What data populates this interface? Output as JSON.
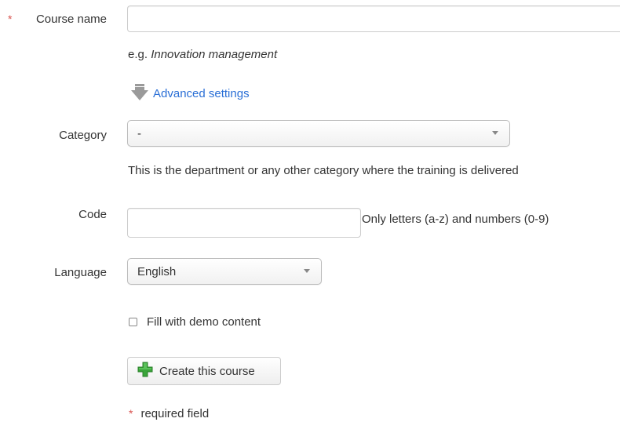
{
  "form": {
    "course_name": {
      "required_mark": "*",
      "label": "Course name",
      "value": "",
      "hint_prefix": "e.g.",
      "hint_example": "Innovation management"
    },
    "advanced_settings": {
      "label": "Advanced settings",
      "icon": "download-arrow-icon"
    },
    "category": {
      "label": "Category",
      "selected": "-",
      "hint": "This is the department or any other category where the training is delivered"
    },
    "code": {
      "label": "Code",
      "value": "",
      "hint": "Only letters (a-z) and numbers (0-9)"
    },
    "language": {
      "label": "Language",
      "selected": "English"
    },
    "demo_content": {
      "label": "Fill with demo content",
      "checked": false
    },
    "submit": {
      "label": "Create this course",
      "icon": "plus-icon"
    },
    "required_note": {
      "mark": "*",
      "text": "required field"
    }
  },
  "colors": {
    "link": "#2a6fd6",
    "required": "#d9534f",
    "plus_icon": "#3aa53a"
  }
}
